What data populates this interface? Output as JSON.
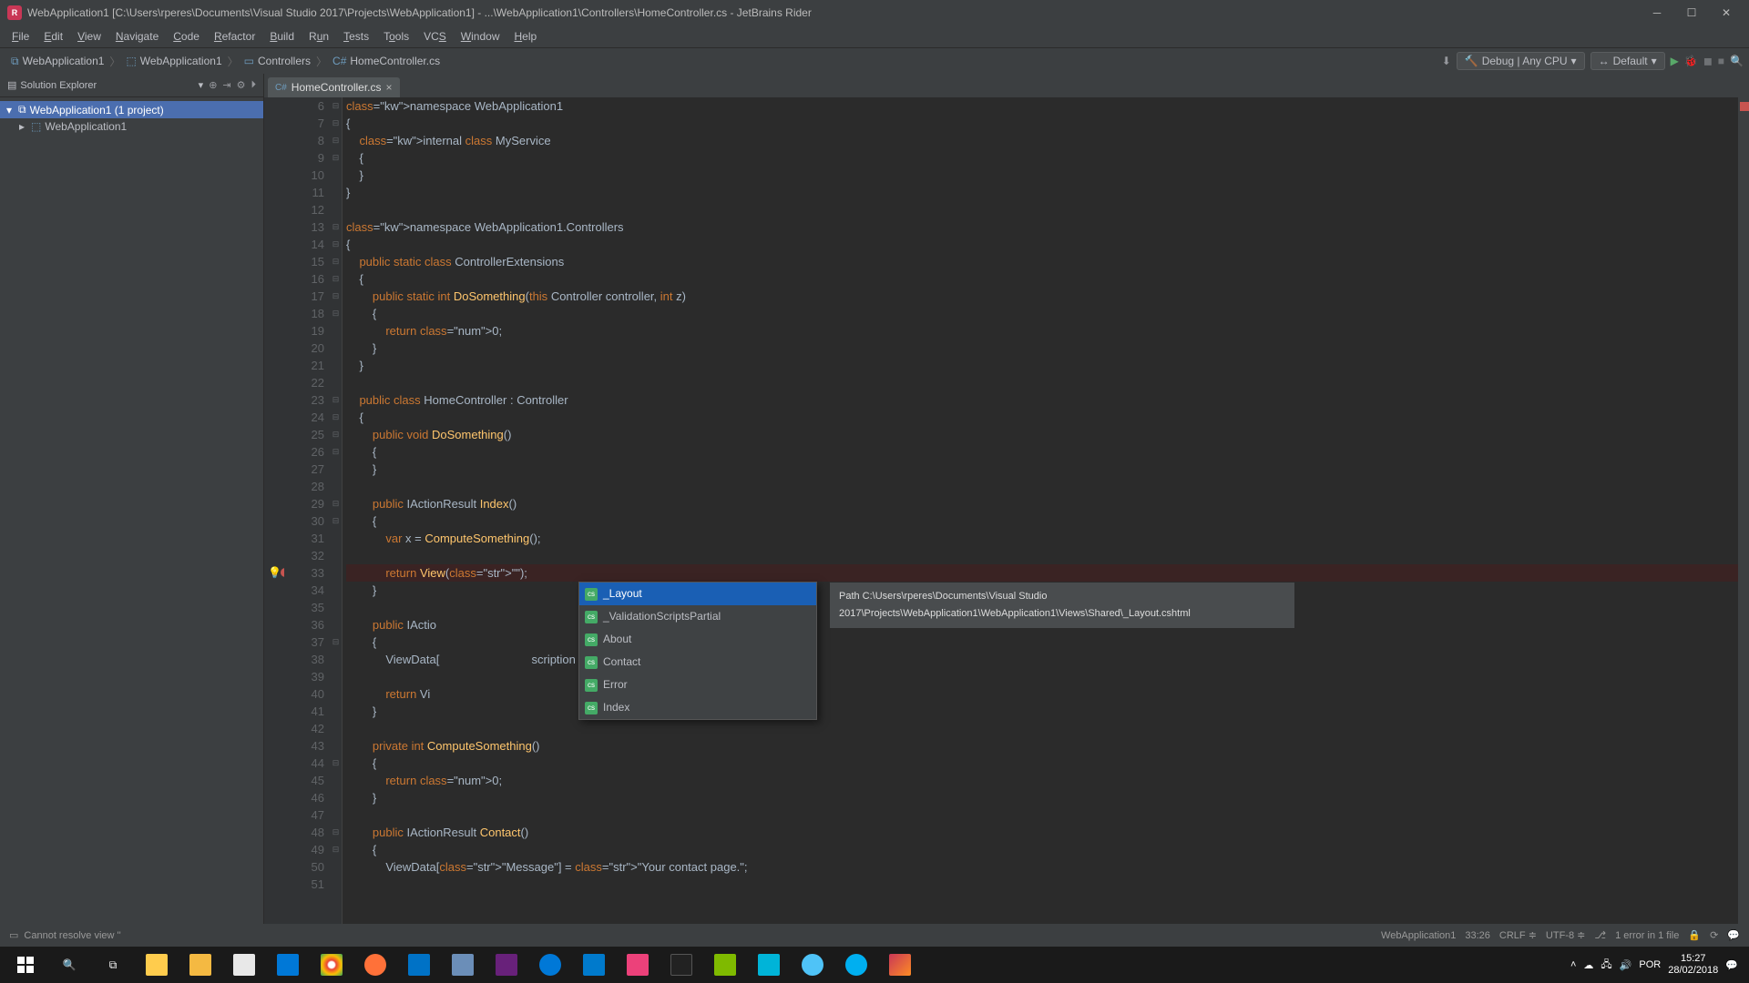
{
  "window": {
    "title": "WebApplication1 [C:\\Users\\rperes\\Documents\\Visual Studio 2017\\Projects\\WebApplication1] - ...\\WebApplication1\\Controllers\\HomeController.cs - JetBrains Rider"
  },
  "menu": [
    "File",
    "Edit",
    "View",
    "Navigate",
    "Code",
    "Refactor",
    "Build",
    "Run",
    "Tests",
    "Tools",
    "VCS",
    "Window",
    "Help"
  ],
  "breadcrumbs": [
    {
      "label": "WebApplication1",
      "icon": "solution"
    },
    {
      "label": "WebApplication1",
      "icon": "project"
    },
    {
      "label": "Controllers",
      "icon": "folder"
    },
    {
      "label": "HomeController.cs",
      "icon": "csharp"
    }
  ],
  "run_config": {
    "label": "Debug | Any CPU"
  },
  "configuration": {
    "label": "Default"
  },
  "solution_explorer": {
    "title": "Solution Explorer",
    "root": "WebApplication1 (1 project)",
    "child": "WebApplication1"
  },
  "tab": {
    "label": "HomeController.cs"
  },
  "line_start": 6,
  "code_lines": [
    "namespace WebApplication1",
    "{",
    "    internal class MyService",
    "    {",
    "    }",
    "}",
    "",
    "namespace WebApplication1.Controllers",
    "{",
    "    public static class ControllerExtensions",
    "    {",
    "        public static int DoSomething(this Controller controller, int z)",
    "        {",
    "            return 0;",
    "        }",
    "    }",
    "",
    "    public class HomeController : Controller",
    "    {",
    "        public void DoSomething()",
    "        {",
    "        }",
    "",
    "        public IActionResult Index()",
    "        {",
    "            var x = ComputeSomething();",
    "",
    "            return View(\"\");",
    "        }",
    "",
    "        public IActio",
    "        {",
    "            ViewData[                            scription page.\";",
    "",
    "            return Vi",
    "        }",
    "",
    "        private int ComputeSomething()",
    "        {",
    "            return 0;",
    "        }",
    "",
    "        public IActionResult Contact()",
    "        {",
    "            ViewData[\"Message\"] = \"Your contact page.\";",
    ""
  ],
  "autocomplete": {
    "items": [
      "_Layout",
      "_ValidationScriptsPartial",
      "About",
      "Contact",
      "Error",
      "Index"
    ],
    "selected": 0,
    "tooltip": "Path C:\\Users\\rperes\\Documents\\Visual Studio 2017\\Projects\\WebApplication1\\WebApplication1\\Views\\Shared\\_Layout.cshtml"
  },
  "status": {
    "message": "Cannot resolve view ''",
    "context": "WebApplication1",
    "cursor": "33:26",
    "linesep": "CRLF",
    "encoding": "UTF-8",
    "errors": "1 error in 1 file"
  },
  "taskbar": {
    "lang": "POR",
    "time": "15:27",
    "date": "28/02/2018"
  }
}
